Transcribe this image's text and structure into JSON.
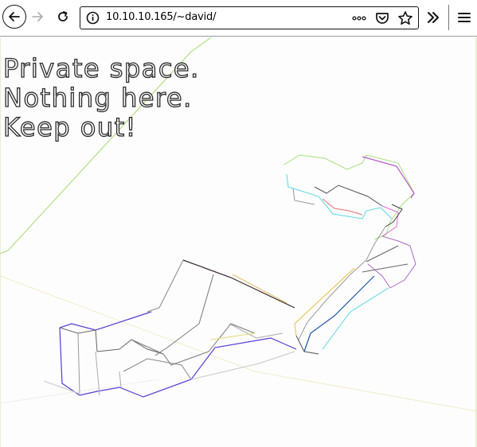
{
  "browser": {
    "url": "10.10.10.165/~david/",
    "icons": {
      "back": "back-arrow-icon",
      "forward": "forward-arrow-icon",
      "reload": "reload-icon",
      "site_info": "info-icon",
      "page_actions": "more-horizontal-icon",
      "pocket": "pocket-icon",
      "bookmark": "star-icon",
      "overflow": "chevron-double-right-icon",
      "menu": "hamburger-menu-icon"
    }
  },
  "page": {
    "lines": [
      "Private space.",
      "Nothing here.",
      "Keep out!"
    ]
  }
}
